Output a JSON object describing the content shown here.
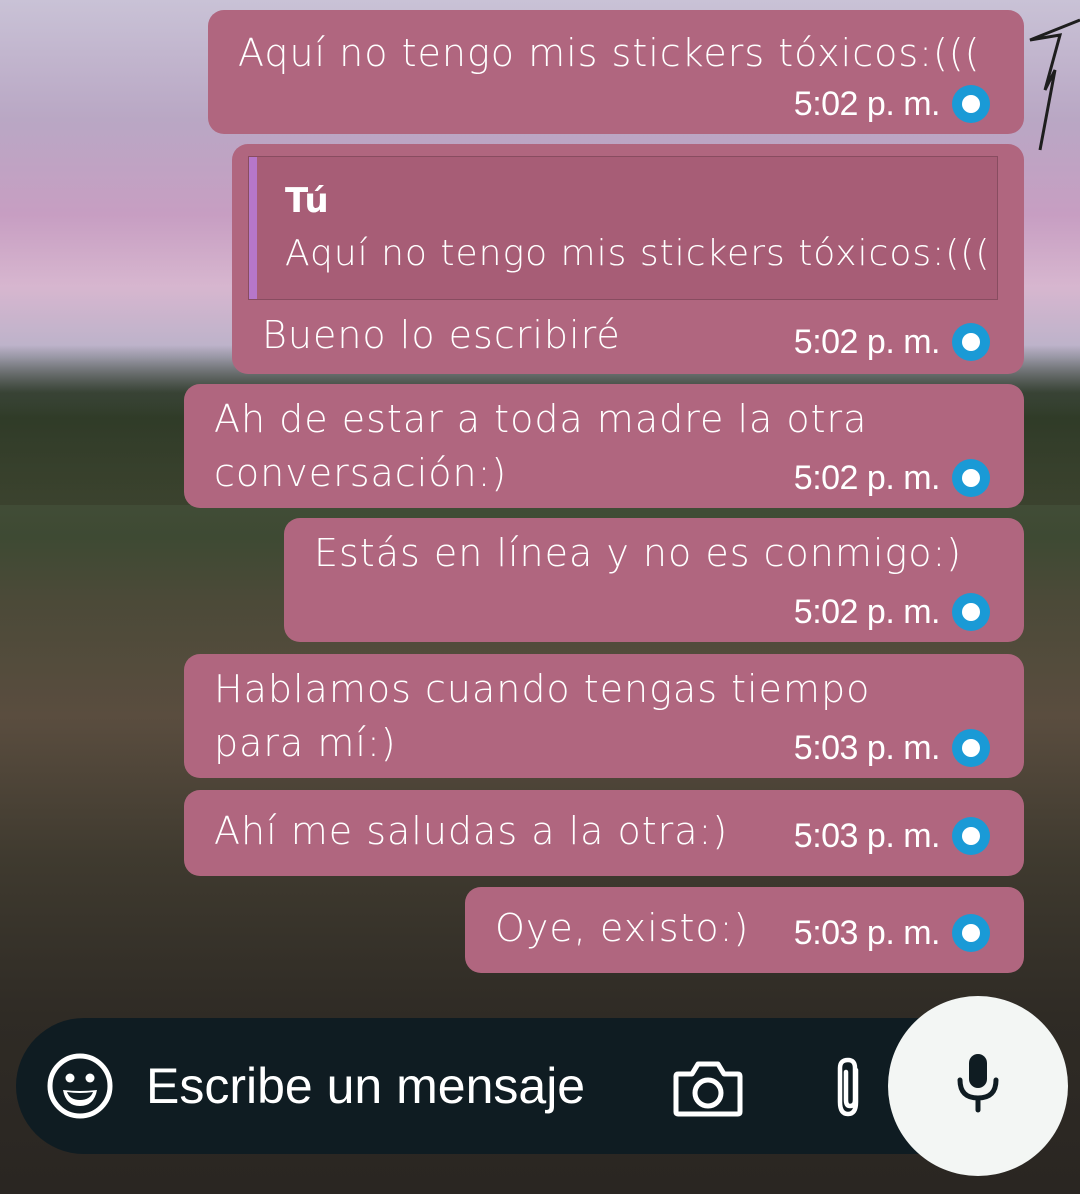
{
  "messages": [
    {
      "text": "Aquí no tengo mis stickers tóxicos:(((",
      "time": "5:02 p. m.",
      "status_icon": "sent-status-icon"
    },
    {
      "reply_to": {
        "author": "Tú",
        "text": "Aquí no tengo mis stickers tóxicos:((("
      },
      "text": "Bueno lo escribiré",
      "time": "5:02 p. m.",
      "status_icon": "sent-status-icon"
    },
    {
      "text": "Ah de estar a toda madre la otra\nconversación:)",
      "time": "5:02 p. m.",
      "status_icon": "sent-status-icon"
    },
    {
      "text": "Estás en línea y no es conmigo:)",
      "time": "5:02 p. m.",
      "status_icon": "sent-status-icon"
    },
    {
      "text": "Hablamos cuando tengas tiempo\npara mí:)",
      "time": "5:03 p. m.",
      "status_icon": "sent-status-icon"
    },
    {
      "text": "Ahí me saludas a la otra:)",
      "time": "5:03 p. m.",
      "status_icon": "sent-status-icon"
    },
    {
      "text": "Oye, existo:)",
      "time": "5:03 p. m.",
      "status_icon": "sent-status-icon"
    }
  ],
  "composer": {
    "placeholder": "Escribe un mensaje",
    "icons": [
      "emoji-icon",
      "camera-icon",
      "attach-icon",
      "microphone-icon"
    ]
  },
  "colors": {
    "bubble": "#b0667f",
    "status": "#1a9ad6",
    "composer": "#0f1c22",
    "quote_bar": "#b677c9"
  }
}
